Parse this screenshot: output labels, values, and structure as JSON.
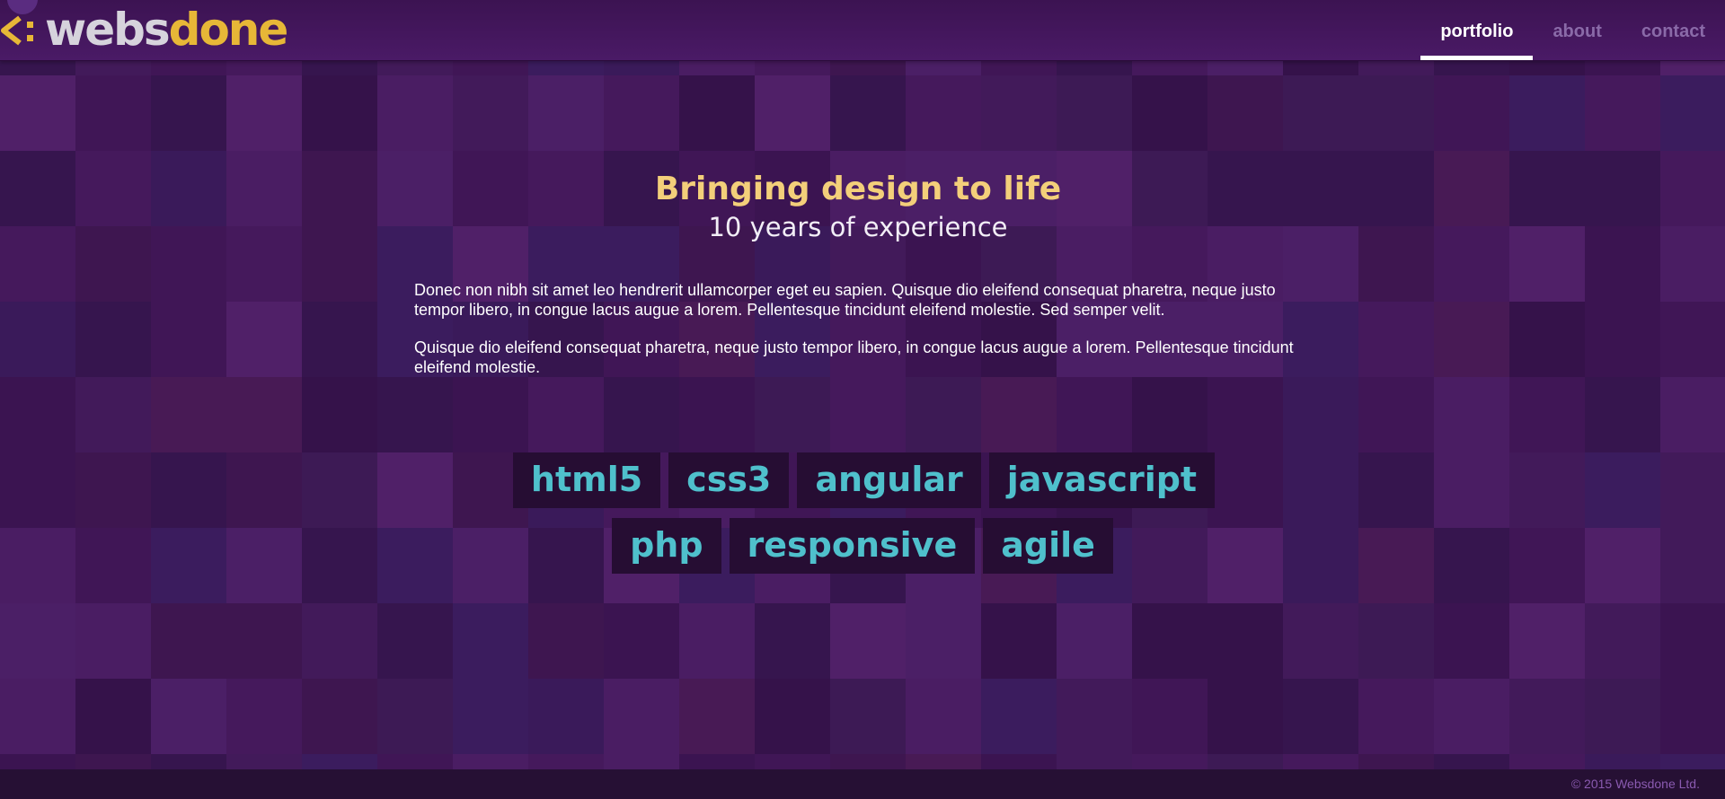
{
  "brand": {
    "name_part1": "webs",
    "name_part2": "done",
    "colors": {
      "webs": "#d6d3dc",
      "done": "#e7b737"
    }
  },
  "nav": {
    "items": [
      {
        "label": "portfolio",
        "active": true
      },
      {
        "label": "about",
        "active": false
      },
      {
        "label": "contact",
        "active": false
      }
    ]
  },
  "hero": {
    "headline": "Bringing design to life",
    "subline": "10 years of experience",
    "paragraphs": [
      "Donec non nibh sit amet leo hendrerit ullamcorper eget eu sapien. Quisque dio eleifend consequat pharetra, neque justo tempor libero, in congue lacus augue a lorem. Pellentesque tincidunt eleifend molestie. Sed semper velit.",
      "Quisque dio eleifend consequat pharetra, neque justo tempor libero, in congue lacus augue a lorem. Pellentesque tincidunt eleifend molestie."
    ]
  },
  "skills": {
    "row1": [
      "html5",
      "css3",
      "angular",
      "javascript"
    ],
    "row2": [
      "php",
      "responsive",
      "agile"
    ]
  },
  "footer": {
    "copyright": "© 2015 Websdone Ltd."
  },
  "colors": {
    "background": "#3a1450",
    "headline": "#f3cf7a",
    "tag_text": "#4fc0cc",
    "tag_bg": "#260d33",
    "nav_inactive": "#8a6aa8"
  }
}
